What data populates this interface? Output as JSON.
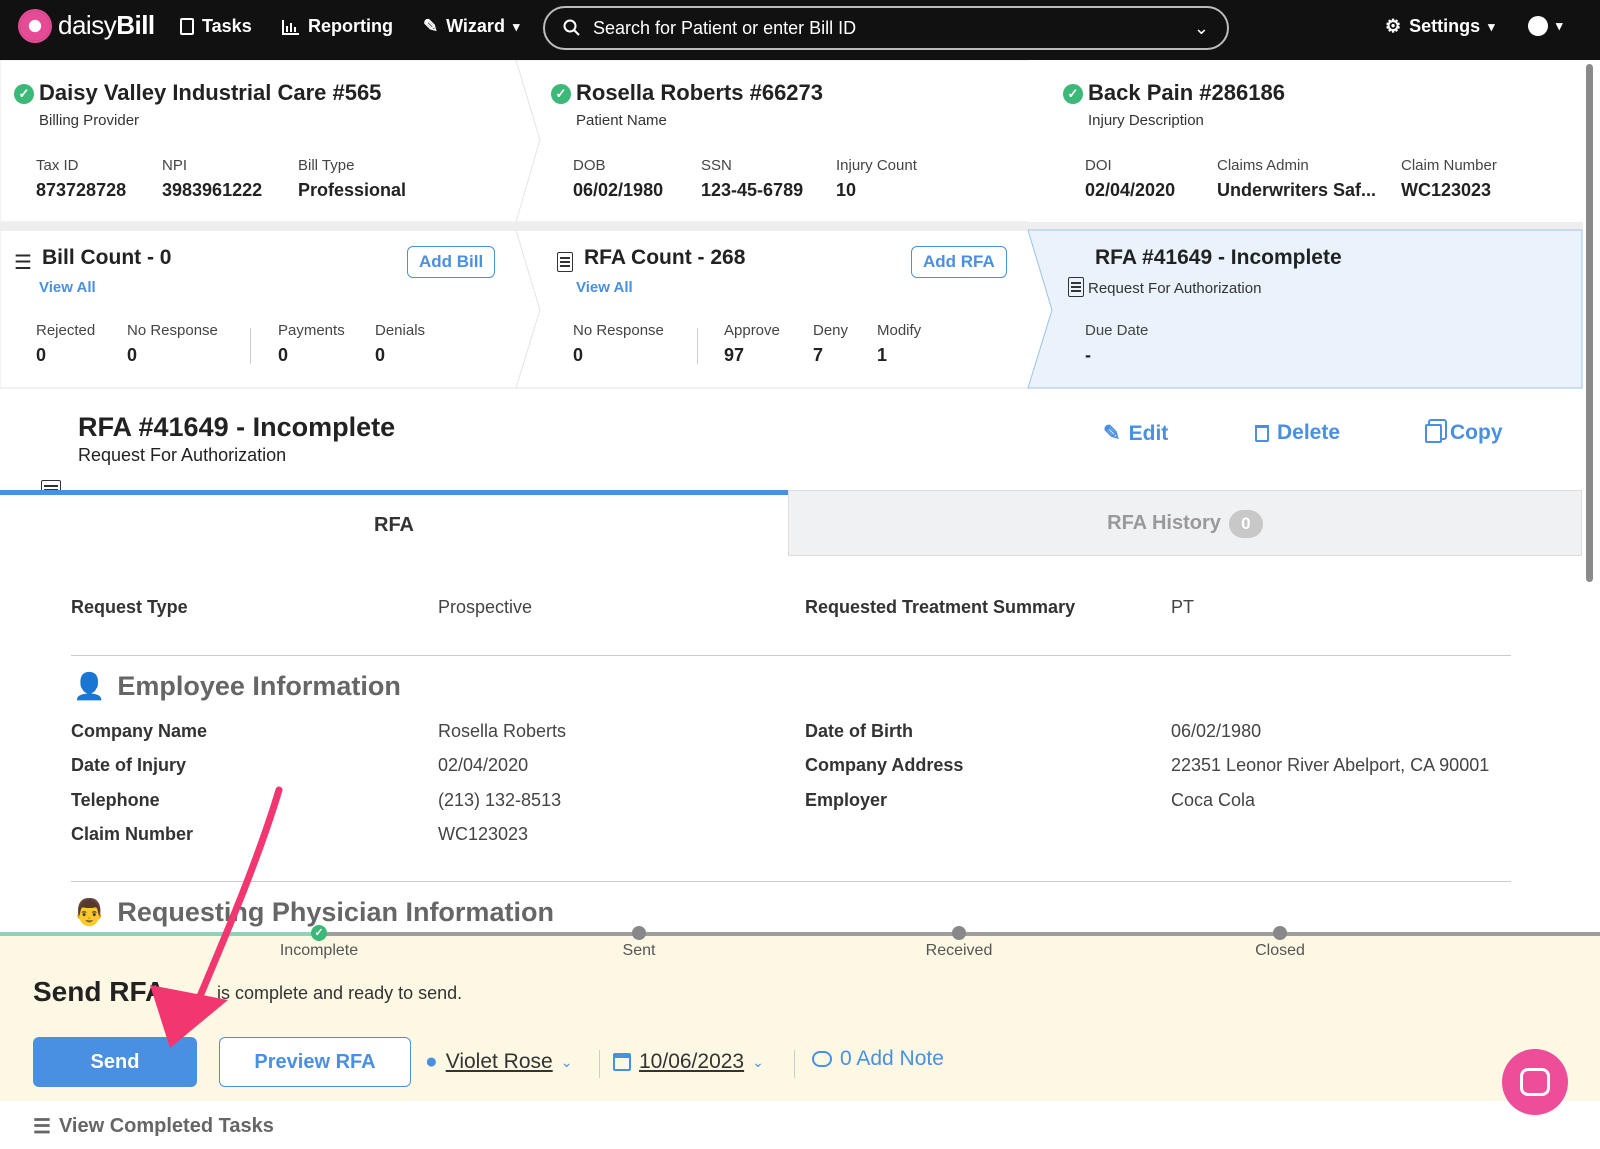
{
  "nav": {
    "brand_light": "daisy",
    "brand_bold": "Bill",
    "tasks": "Tasks",
    "reporting": "Reporting",
    "wizard": "Wizard",
    "search_placeholder": "Search for Patient or enter Bill ID",
    "settings": "Settings"
  },
  "provider": {
    "title": "Daisy Valley Industrial Care #565",
    "subtitle": "Billing Provider",
    "fields": [
      {
        "label": "Tax ID",
        "value": "873728728"
      },
      {
        "label": "NPI",
        "value": "3983961222"
      },
      {
        "label": "Bill Type",
        "value": "Professional"
      }
    ]
  },
  "patient": {
    "title": "Rosella Roberts #66273",
    "subtitle": "Patient Name",
    "fields": [
      {
        "label": "DOB",
        "value": "06/02/1980"
      },
      {
        "label": "SSN",
        "value": "123-45-6789"
      },
      {
        "label": "Injury Count",
        "value": "10"
      }
    ]
  },
  "injury": {
    "title": "Back Pain #286186",
    "subtitle": "Injury Description",
    "fields": [
      {
        "label": "DOI",
        "value": "02/04/2020"
      },
      {
        "label": "Claims Admin",
        "value": "Underwriters Saf..."
      },
      {
        "label": "Claim Number",
        "value": "WC123023"
      }
    ]
  },
  "bills": {
    "title": "Bill Count - 0",
    "add_label": "Add Bill",
    "view_all": "View All",
    "fields": [
      {
        "label": "Rejected",
        "value": "0"
      },
      {
        "label": "No Response",
        "value": "0"
      },
      {
        "label": "Payments",
        "value": "0"
      },
      {
        "label": "Denials",
        "value": "0"
      }
    ]
  },
  "rfas": {
    "title": "RFA Count - 268",
    "add_label": "Add RFA",
    "view_all": "View All",
    "fields": [
      {
        "label": "No Response",
        "value": "0"
      },
      {
        "label": "Approve",
        "value": "97"
      },
      {
        "label": "Deny",
        "value": "7"
      },
      {
        "label": "Modify",
        "value": "1"
      }
    ]
  },
  "current_rfa": {
    "title": "RFA #41649 - Incomplete",
    "subtitle": "Request For Authorization",
    "due_label": "Due Date",
    "due_value": "-"
  },
  "header": {
    "title": "RFA #41649 - Incomplete",
    "subtitle": "Request For Authorization",
    "edit": "Edit",
    "delete": "Delete",
    "copy": "Copy"
  },
  "tabs": {
    "rfa": "RFA",
    "history": "RFA History",
    "history_count": "0"
  },
  "request": {
    "type_label": "Request Type",
    "type_value": "Prospective",
    "summary_label": "Requested Treatment Summary",
    "summary_value": "PT"
  },
  "employee": {
    "section_title": "Employee Information",
    "left": [
      {
        "label": "Company Name",
        "value": "Rosella Roberts"
      },
      {
        "label": "Date of Injury",
        "value": "02/04/2020"
      },
      {
        "label": "Telephone",
        "value": "(213) 132-8513"
      },
      {
        "label": "Claim Number",
        "value": "WC123023"
      }
    ],
    "right": [
      {
        "label": "Date of Birth",
        "value": "06/02/1980"
      },
      {
        "label": "Company Address",
        "value": "22351 Leonor River Abelport, CA 90001"
      },
      {
        "label": "Employer",
        "value": "Coca Cola"
      }
    ]
  },
  "physician": {
    "section_title": "Requesting Physician Information"
  },
  "progress": {
    "steps": [
      "Incomplete",
      "Sent",
      "Received",
      "Closed"
    ]
  },
  "send_panel": {
    "title": "Send RFA",
    "message": "is complete and ready to send.",
    "send": "Send",
    "preview": "Preview RFA",
    "assignee": "Violet Rose",
    "date": "10/06/2023",
    "note": "0 Add Note"
  },
  "footer": {
    "view_completed": "View Completed Tasks"
  },
  "colors": {
    "accent": "#4a90e2",
    "check": "#3cb878",
    "annotation_arrow": "#f2366f",
    "chat": "#ee4d9a"
  }
}
